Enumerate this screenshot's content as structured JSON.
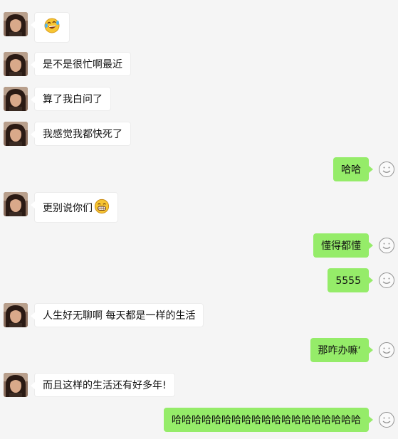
{
  "colors": {
    "background": "#f5f5f5",
    "incoming_bubble": "#ffffff",
    "outgoing_bubble": "#95ec69"
  },
  "messages": [
    {
      "side": "in",
      "emoji": "rofl-emoji"
    },
    {
      "side": "in",
      "text": "是不是很忙啊最近"
    },
    {
      "side": "in",
      "text": "算了我白问了"
    },
    {
      "side": "in",
      "text": "我感觉我都快死了"
    },
    {
      "side": "out",
      "text": "哈哈"
    },
    {
      "side": "in",
      "text": "更别说你们",
      "emoji": "grin-emoji"
    },
    {
      "side": "out",
      "text": "懂得都懂"
    },
    {
      "side": "out",
      "text": "5555"
    },
    {
      "side": "in",
      "text": "人生好无聊啊 每天都是一样的生活"
    },
    {
      "side": "out",
      "text": "那咋办嘛‘"
    },
    {
      "side": "in",
      "text": "而且这样的生活还有好多年!"
    },
    {
      "side": "out",
      "text": "哈哈哈哈哈哈哈哈哈哈哈哈哈哈哈哈哈哈哈"
    }
  ]
}
